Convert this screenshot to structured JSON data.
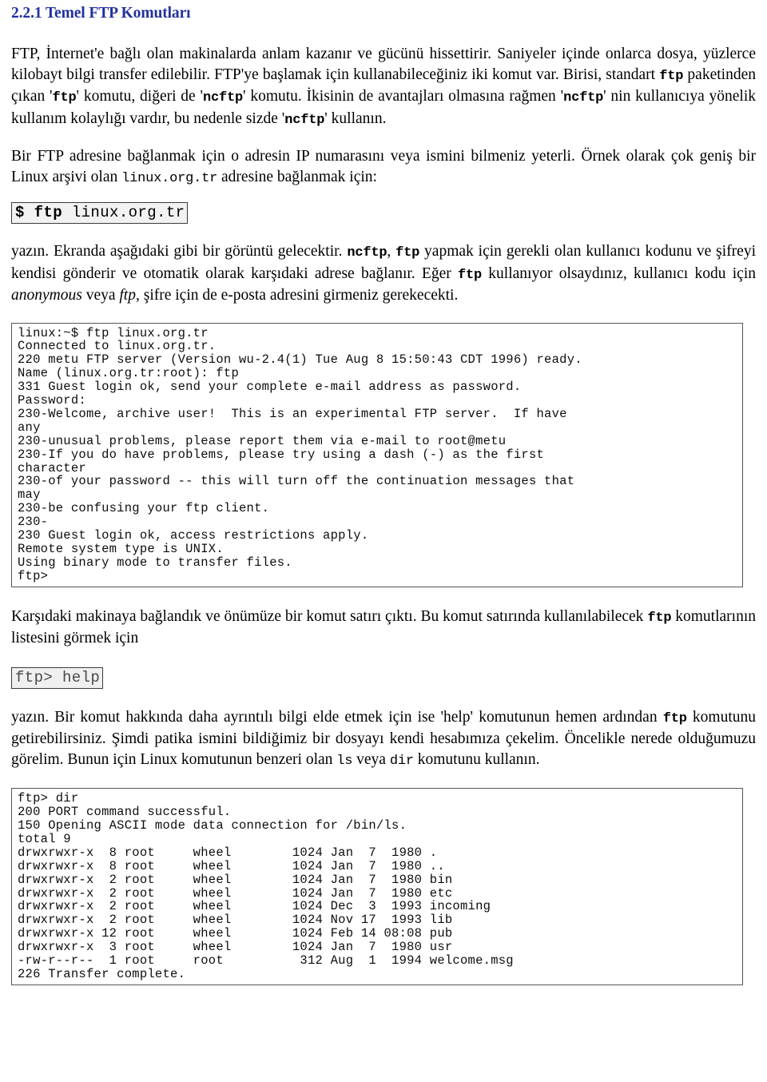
{
  "document": {
    "heading": "2.2.1 Temel FTP Komutları",
    "accent_color": "#22309c",
    "text_color": "#000000",
    "background_color": "#ffffff"
  },
  "paragraphs": {
    "p1": {
      "seg1": "FTP, İnternet'e bağlı olan makinalarda anlam kazanır ve gücünü hissettirir. Saniyeler içinde onlarca dosya, yüzlerce kilobayt bilgi transfer edilebilir. FTP'ye başlamak için kullanabileceğiniz iki komut var. Birisi, standart ",
      "code1": "ftp",
      "seg2": " paketinden çıkan '",
      "code2": "ftp",
      "seg3": "' komutu, diğeri de '",
      "code3": "ncftp",
      "seg4": "' komutu. İkisinin de avantajları olmasına rağmen '",
      "code4": "ncftp",
      "seg5": "' nin kullanıcıya yönelik kullanım kolaylığı vardır, bu nedenle sizde '",
      "code5": "ncftp",
      "seg6": "' kullanın."
    },
    "p2": {
      "seg1": "Bir FTP adresine bağlanmak için o adresin IP numarasını veya ismini bilmeniz yeterli. Örnek olarak çok geniş bir Linux arşivi olan ",
      "code1": "linux.org.tr",
      "seg2": " adresine bağlanmak için:"
    },
    "p3": {
      "seg1": "yazın. Ekranda aşağıdaki gibi bir görüntü gelecektir. ",
      "code1": "ncftp",
      "seg2": ", ",
      "code2": "ftp",
      "seg3": " yapmak için gerekli olan kullanıcı kodunu ve şifreyi kendisi gönderir ve otomatik olarak karşıdaki adrese bağlanır. Eğer ",
      "code3": "ftp",
      "seg4": " kullanıyor olsaydınız, kullanıcı kodu için ",
      "ital1": "anonymous",
      "seg5": " veya ",
      "ital2": "ftp",
      "seg6": ", şifre için de e-posta adresini girmeniz gerekecekti."
    },
    "p4": {
      "seg1": "Karşıdaki makinaya bağlandık ve önümüze bir komut satırı çıktı. Bu komut satırında kullanılabilecek ",
      "code1": "ftp",
      "seg2": " komutlarının listesini görmek için"
    },
    "p5": {
      "seg1": "yazın. Bir komut hakkında daha ayrıntılı bilgi elde etmek için ise 'help' komutunun hemen ardından ",
      "code1": "ftp",
      "seg2": " komutunu getirebilirsiniz. Şimdi patika ismini bildiğimiz bir dosyayı kendi hesabımıza çekelim. Öncelikle nerede olduğumuzu görelim. Bunun için Linux komutunun benzeri olan ",
      "code2": "ls",
      "seg3": " veya ",
      "code3": "dir",
      "seg4": " komutunu kullanın."
    }
  },
  "command_boxes": {
    "box1": {
      "bold_part": "$ ftp",
      "plain_part": " linux.org.tr"
    },
    "box2": {
      "text": "ftp> help"
    }
  },
  "terminals": {
    "session1_lines": [
      "linux:~$ ftp linux.org.tr",
      "Connected to linux.org.tr.",
      "220 metu FTP server (Version wu-2.4(1) Tue Aug 8 15:50:43 CDT 1996) ready.",
      "Name (linux.org.tr:root): ftp",
      "331 Guest login ok, send your complete e-mail address as password.",
      "Password:",
      "230-Welcome, archive user!  This is an experimental FTP server.  If have",
      "any",
      "230-unusual problems, please report them via e-mail to root@metu",
      "230-If you do have problems, please try using a dash (-) as the first",
      "character",
      "230-of your password -- this will turn off the continuation messages that",
      "may",
      "230-be confusing your ftp client.",
      "230-",
      "230 Guest login ok, access restrictions apply.",
      "Remote system type is UNIX.",
      "Using binary mode to transfer files.",
      "ftp>"
    ],
    "session2_lines": [
      "ftp> dir",
      "200 PORT command successful.",
      "150 Opening ASCII mode data connection for /bin/ls.",
      "total 9",
      "drwxrwxr-x  8 root     wheel        1024 Jan  7  1980 .",
      "drwxrwxr-x  8 root     wheel        1024 Jan  7  1980 ..",
      "drwxrwxr-x  2 root     wheel        1024 Jan  7  1980 bin",
      "drwxrwxr-x  2 root     wheel        1024 Jan  7  1980 etc",
      "drwxrwxr-x  2 root     wheel        1024 Dec  3  1993 incoming",
      "drwxrwxr-x  2 root     wheel        1024 Nov 17  1993 lib",
      "drwxrwxr-x 12 root     wheel        1024 Feb 14 08:08 pub",
      "drwxrwxr-x  3 root     wheel        1024 Jan  7  1980 usr",
      "-rw-r--r--  1 root     root          312 Aug  1  1994 welcome.msg",
      "226 Transfer complete."
    ]
  }
}
